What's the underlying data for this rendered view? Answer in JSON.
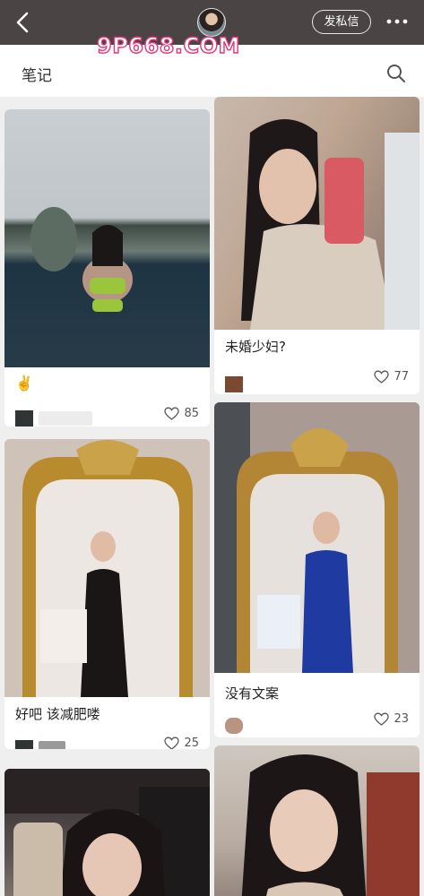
{
  "topbar": {
    "dm_label": "发私信"
  },
  "watermark": "9P668.COM",
  "header": {
    "title": "笔记"
  },
  "cards": [
    {
      "title": "✌️",
      "author": "",
      "likes": "85"
    },
    {
      "title": "未婚少妇?",
      "author": "",
      "likes": "77"
    },
    {
      "title": "好吧 该减肥喽",
      "author": "",
      "likes": "25"
    },
    {
      "title": "没有文案",
      "author": "",
      "likes": "23"
    },
    {
      "title": "",
      "author": "",
      "likes": ""
    },
    {
      "title": "",
      "author": "",
      "likes": ""
    }
  ],
  "colors": {
    "topbar": "#4a4445",
    "watermark_stroke": "#e0377a"
  }
}
